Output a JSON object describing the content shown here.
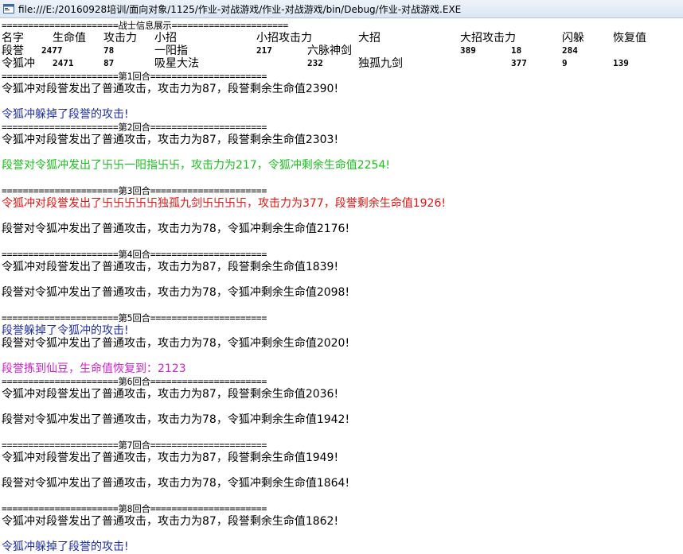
{
  "window": {
    "title": "file:///E:/20160928培训/面向对象/1125/作业-对战游戏/作业-对战游戏/bin/Debug/作业-对战游戏.EXE"
  },
  "info_header": "======================战士信息展示======================",
  "table": {
    "headers": [
      "名字",
      "生命值",
      "攻击力",
      "小招",
      "小招攻击力",
      "大招",
      "大招攻击力",
      "闪躲",
      "恢复值"
    ],
    "rows": [
      [
        "段誉",
        "2477",
        "78",
        "一阳指",
        "217",
        "六脉神剑",
        "389",
        "18",
        "284"
      ],
      [
        "令狐冲",
        "2471",
        "87",
        "吸星大法",
        "232",
        "独孤九剑",
        "377",
        "9",
        "139"
      ]
    ]
  },
  "log": [
    {
      "text": "======================第1回合======================",
      "color": "default"
    },
    {
      "text": "令狐冲对段誉发出了普通攻击，攻击力为87，段誉剩余生命值2390!",
      "color": "default"
    },
    {
      "text": "",
      "color": "default"
    },
    {
      "text": "令狐冲躲掉了段誉的攻击!",
      "color": "blue"
    },
    {
      "text": "======================第2回合======================",
      "color": "default"
    },
    {
      "text": "令狐冲对段誉发出了普通攻击，攻击力为87，段誉剩余生命值2303!",
      "color": "default"
    },
    {
      "text": "",
      "color": "default"
    },
    {
      "text": "段誉对令狐冲发出了卐卐一阳指卐卐，攻击力为217，令狐冲剩余生命值2254!",
      "color": "green"
    },
    {
      "text": "",
      "color": "default"
    },
    {
      "text": "======================第3回合======================",
      "color": "default"
    },
    {
      "text": "令狐冲对段誉发出了卐卐卐卐卐独孤九剑卐卐卐卐，攻击力为377，段誉剩余生命值1926!",
      "color": "red"
    },
    {
      "text": "",
      "color": "default"
    },
    {
      "text": "段誉对令狐冲发出了普通攻击，攻击力为78，令狐冲剩余生命值2176!",
      "color": "default"
    },
    {
      "text": "",
      "color": "default"
    },
    {
      "text": "======================第4回合======================",
      "color": "default"
    },
    {
      "text": "令狐冲对段誉发出了普通攻击，攻击力为87，段誉剩余生命值1839!",
      "color": "default"
    },
    {
      "text": "",
      "color": "default"
    },
    {
      "text": "段誉对令狐冲发出了普通攻击，攻击力为78，令狐冲剩余生命值2098!",
      "color": "default"
    },
    {
      "text": "",
      "color": "default"
    },
    {
      "text": "======================第5回合======================",
      "color": "default"
    },
    {
      "text": "段誉躲掉了令狐冲的攻击!",
      "color": "blue"
    },
    {
      "text": "段誉对令狐冲发出了普通攻击，攻击力为78，令狐冲剩余生命值2020!",
      "color": "default"
    },
    {
      "text": "",
      "color": "default"
    },
    {
      "text": "段誉拣到仙豆，生命值恢复到：2123",
      "color": "magenta"
    },
    {
      "text": "======================第6回合======================",
      "color": "default"
    },
    {
      "text": "令狐冲对段誉发出了普通攻击，攻击力为87，段誉剩余生命值2036!",
      "color": "default"
    },
    {
      "text": "",
      "color": "default"
    },
    {
      "text": "段誉对令狐冲发出了普通攻击，攻击力为78，令狐冲剩余生命值1942!",
      "color": "default"
    },
    {
      "text": "",
      "color": "default"
    },
    {
      "text": "======================第7回合======================",
      "color": "default"
    },
    {
      "text": "令狐冲对段誉发出了普通攻击，攻击力为87，段誉剩余生命值1949!",
      "color": "default"
    },
    {
      "text": "",
      "color": "default"
    },
    {
      "text": "段誉对令狐冲发出了普通攻击，攻击力为78，令狐冲剩余生命值1864!",
      "color": "default"
    },
    {
      "text": "",
      "color": "default"
    },
    {
      "text": "======================第8回合======================",
      "color": "default"
    },
    {
      "text": "令狐冲对段誉发出了普通攻击，攻击力为87，段誉剩余生命值1862!",
      "color": "default"
    },
    {
      "text": "",
      "color": "default"
    },
    {
      "text": "令狐冲躲掉了段誉的攻击!",
      "color": "blue"
    }
  ],
  "colors": {
    "blue": "#1e2ea8",
    "green": "#19c11b",
    "red": "#e8120e",
    "magenta": "#d21fcf"
  }
}
